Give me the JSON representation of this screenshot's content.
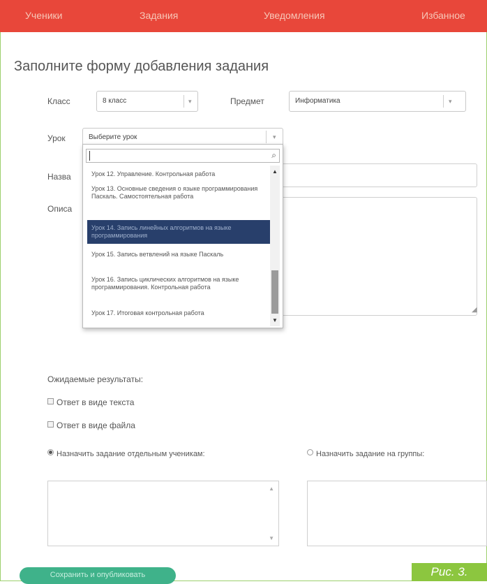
{
  "nav": {
    "items": [
      "Ученики",
      "Задания",
      "Уведомления",
      "Избанное"
    ]
  },
  "page_title": "Заполните форму добавления задания",
  "form": {
    "class_label": "Класс",
    "class_value": "8 класс",
    "subject_label": "Предмет",
    "subject_value": "Информатика",
    "lesson_label": "Урок",
    "lesson_value": "Выберите урок",
    "name_label": "Назва",
    "desc_label": "Описа"
  },
  "dropdown": {
    "search_value": "",
    "items": [
      "Урок 12. Управление. Контрольная работа",
      "Урок 13. Основные сведения о языке программирования Паскаль. Самостоятельная работа",
      "Урок 14. Запись линейных алгоритмов на языке программирования",
      "Урок 15. Запись ветвлений на языке Паскаль",
      "Урок 16. Запись циклических алгоритмов на языке программирования. Контрольная работа",
      "Урок 17. Итоговая контрольная работа"
    ],
    "selected_index": 2
  },
  "results": {
    "label": "Ожидаемые результаты:",
    "option_text": "Ответ в виде текста",
    "option_file": "Ответ в виде файла"
  },
  "assign": {
    "individual": "Назначить задание отдельным ученикам:",
    "groups": "Назначить задание на группы:"
  },
  "save_button": "Сохранить и опубликовать",
  "figure_label": "Рис. 3.",
  "colors": {
    "nav_bg": "#e8473a",
    "selected_bg": "#283f6b",
    "save_bg": "#3fb28a",
    "figure_bg": "#8cc63f"
  }
}
